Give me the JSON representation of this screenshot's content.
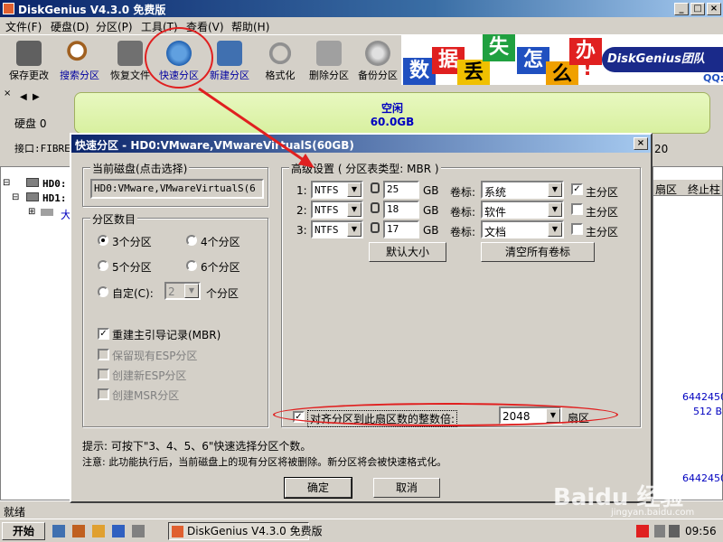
{
  "window": {
    "title": "DiskGenius V4.3.0 免费版"
  },
  "menu": [
    "文件(F)",
    "硬盘(D)",
    "分区(P)",
    "工具(T)",
    "查看(V)",
    "帮助(H)"
  ],
  "toolbar": [
    "保存更改",
    "搜索分区",
    "恢复文件",
    "快速分区",
    "新建分区",
    "格式化",
    "删除分区",
    "备份分区"
  ],
  "banner": {
    "chars": [
      "数",
      "据",
      "丢",
      "失",
      "怎",
      "么",
      "办",
      "!"
    ],
    "brand": "DiskGenius团队",
    "qq": "QQ:"
  },
  "disk": {
    "label": "硬盘 0",
    "interface": "接口:FIBRE",
    "free": "空闲",
    "size": "60.0GB",
    "col_right": "20"
  },
  "tree": {
    "hd0": "HD0:",
    "hd1": "HD1:",
    "child": "大"
  },
  "list_headers": [
    "扇区",
    "终止柱"
  ],
  "right_values": [
    "6442450",
    "512 B",
    "6442450"
  ],
  "dialog": {
    "title": "快速分区 - HD0:VMware,VMwareVirtualS(60GB)",
    "current_disk": {
      "group": "当前磁盘(点击选择)",
      "value": "HD0:VMware,VMwareVirtualS(6"
    },
    "count": {
      "group": "分区数目",
      "options": [
        "3个分区",
        "4个分区",
        "5个分区",
        "6个分区"
      ],
      "custom_label": "自定(C):",
      "custom_value": "2",
      "custom_suffix": "个分区",
      "checks": [
        {
          "label": "重建主引导记录(MBR)",
          "checked": true,
          "enabled": true
        },
        {
          "label": "保留现有ESP分区",
          "checked": false,
          "enabled": false
        },
        {
          "label": "创建新ESP分区",
          "checked": false,
          "enabled": false
        },
        {
          "label": "创建MSR分区",
          "checked": false,
          "enabled": false
        }
      ]
    },
    "advanced": {
      "group": "高级设置 ( 分区表类型: MBR )",
      "rows": [
        {
          "num": "1:",
          "fs": "NTFS",
          "size": "25",
          "unit": "GB",
          "vol_label": "卷标:",
          "vol": "系统",
          "primary": true,
          "primary_label": "主分区"
        },
        {
          "num": "2:",
          "fs": "NTFS",
          "size": "18",
          "unit": "GB",
          "vol_label": "卷标:",
          "vol": "软件",
          "primary": false,
          "primary_label": "主分区"
        },
        {
          "num": "3:",
          "fs": "NTFS",
          "size": "17",
          "unit": "GB",
          "vol_label": "卷标:",
          "vol": "文档",
          "primary": false,
          "primary_label": "主分区"
        }
      ],
      "default_size_btn": "默认大小",
      "clear_labels_btn": "清空所有卷标",
      "align_label": "对齐分区到此扇区数的整数倍:",
      "align_value": "2048",
      "align_unit": "扇区"
    },
    "hint": "提示: 可按下\"3、4、5、6\"快速选择分区个数。",
    "note": "注意: 此功能执行后，当前磁盘上的现有分区将被删除。新分区将会被快速格式化。",
    "ok": "确定",
    "cancel": "取消"
  },
  "status": "就绪",
  "taskbar": {
    "start": "开始",
    "task": "DiskGenius V4.3.0 免费版",
    "clock": "09:56"
  },
  "watermark": {
    "brand": "Baidu 经验",
    "url": "jingyan.baidu.com"
  }
}
